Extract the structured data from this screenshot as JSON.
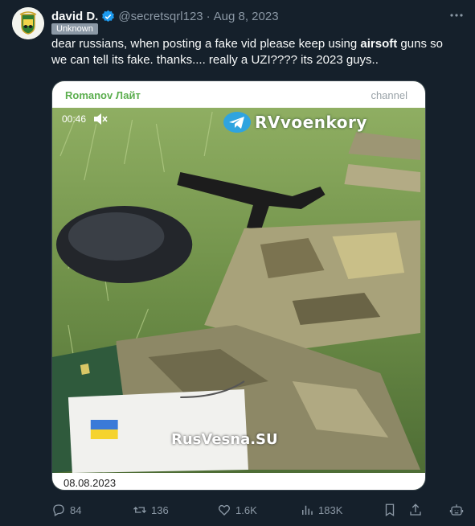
{
  "tweet": {
    "display_name": "david D.",
    "handle": "@secretsqrl123",
    "separator": "·",
    "date": "Aug 8, 2023",
    "badge": "Unknown",
    "text_before": "dear russians, when posting a fake vid please keep using ",
    "text_bold": "airsoft",
    "text_after": " guns so we can tell its fake.  thanks.... really a UZI???? its 2023 guys..",
    "more_icon": "ellipsis-icon"
  },
  "media": {
    "channel_name": "Romanov Лайт",
    "channel_tag": "channel",
    "video_time": "00:46",
    "watermark_top": "RVvoenkory",
    "watermark_bottom": "RusVesna.SU",
    "footer_date": "08.08.2023"
  },
  "actions": {
    "replies": "84",
    "retweets": "136",
    "likes": "1.6K",
    "views": "183K"
  },
  "colors": {
    "background": "#15202b",
    "text": "#f7f9f9",
    "muted": "#8b98a5",
    "verified": "#1d9bf0",
    "channel_green": "#5cae4f"
  }
}
